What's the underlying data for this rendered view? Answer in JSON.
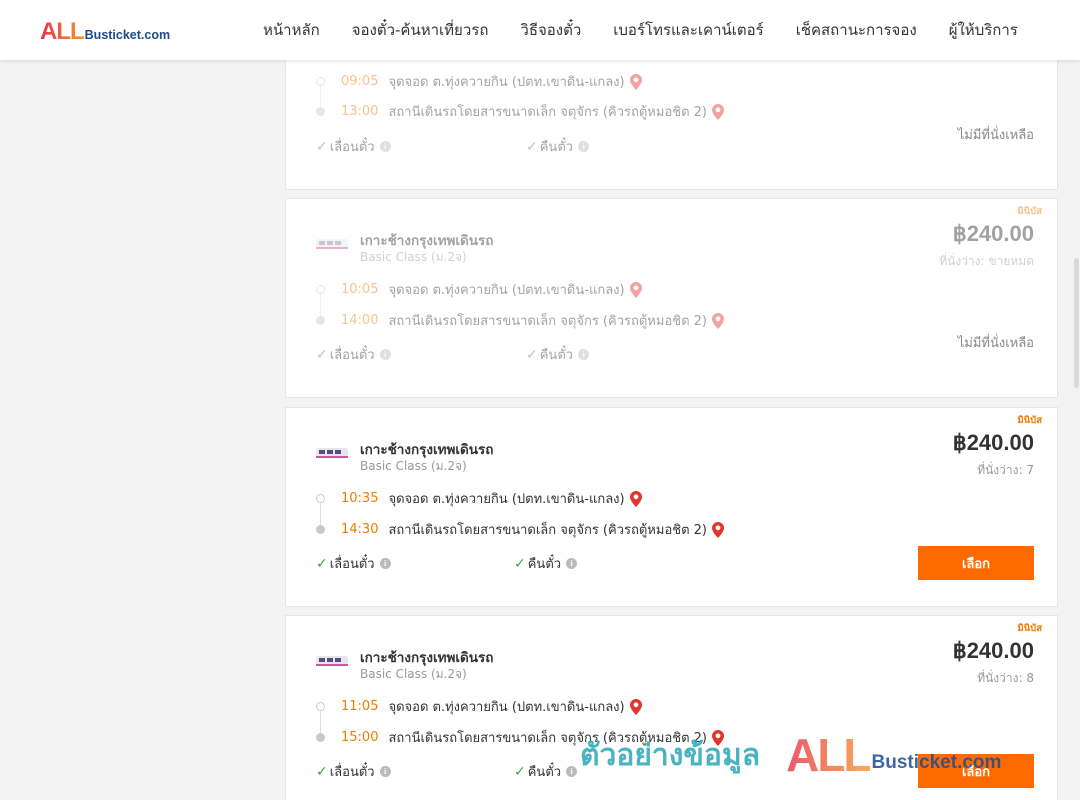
{
  "header": {
    "logo_all": "ALL",
    "logo_rest": "Busticket.com",
    "nav": [
      "หน้าหลัก",
      "จองตั๋ว-ค้นหาเที่ยวรถ",
      "วิธีจองตั๋ว",
      "เบอร์โทรและเคาน์เตอร์",
      "เช็คสถานะการจอง",
      "ผู้ให้บริการ"
    ]
  },
  "colors": {
    "accent": "#ff6a00",
    "time": "#f07b00",
    "check": "#3ca047",
    "pin": "#e2352f"
  },
  "trips": [
    {
      "depart_time": "09:05",
      "depart_place": "จุดจอด ต.ทุ่งควายกิน (ปตท.เขาดิน-แกลง)",
      "arrive_time": "13:00",
      "arrive_place": "สถานีเดินรถโดยสารขนาดเล็ก จตุจักร (คิวรถตู้หมอชิต 2)",
      "option_change": "เลื่อนตั๋ว",
      "option_refund": "คืนตั๋ว",
      "status": "ไม่มีที่นั่งเหลือ"
    },
    {
      "badge": "มินิบัส",
      "operator": "เกาะช้างกรุงเทพเดินรถ",
      "class": "Basic Class (ม.2จ)",
      "price": "฿240.00",
      "seats": "ที่นั่งว่าง: ขายหมด",
      "depart_time": "10:05",
      "depart_place": "จุดจอด ต.ทุ่งควายกิน (ปตท.เขาดิน-แกลง)",
      "arrive_time": "14:00",
      "arrive_place": "สถานีเดินรถโดยสารขนาดเล็ก จตุจักร (คิวรถตู้หมอชิต 2)",
      "option_change": "เลื่อนตั๋ว",
      "option_refund": "คืนตั๋ว",
      "status": "ไม่มีที่นั่งเหลือ"
    },
    {
      "badge": "มินิบัส",
      "operator": "เกาะช้างกรุงเทพเดินรถ",
      "class": "Basic Class (ม.2จ)",
      "price": "฿240.00",
      "seats": "ที่นั่งว่าง: 7",
      "depart_time": "10:35",
      "depart_place": "จุดจอด ต.ทุ่งควายกิน (ปตท.เขาดิน-แกลง)",
      "arrive_time": "14:30",
      "arrive_place": "สถานีเดินรถโดยสารขนาดเล็ก จตุจักร (คิวรถตู้หมอชิต 2)",
      "option_change": "เลื่อนตั๋ว",
      "option_refund": "คืนตั๋ว",
      "button": "เลือก"
    },
    {
      "badge": "มินิบัส",
      "operator": "เกาะช้างกรุงเทพเดินรถ",
      "class": "Basic Class (ม.2จ)",
      "price": "฿240.00",
      "seats": "ที่นั่งว่าง: 8",
      "depart_time": "11:05",
      "depart_place": "จุดจอด ต.ทุ่งควายกิน (ปตท.เขาดิน-แกลง)",
      "arrive_time": "15:00",
      "arrive_place": "สถานีเดินรถโดยสารขนาดเล็ก จตุจักร (คิวรถตู้หมอชิต 2)",
      "option_change": "เลื่อนตั๋ว",
      "option_refund": "คืนตั๋ว",
      "button": "เลือก"
    }
  ],
  "watermark": {
    "text": "ตัวอย่างข้อมูล",
    "all": "ALL",
    "rest": "Busticket.com"
  }
}
